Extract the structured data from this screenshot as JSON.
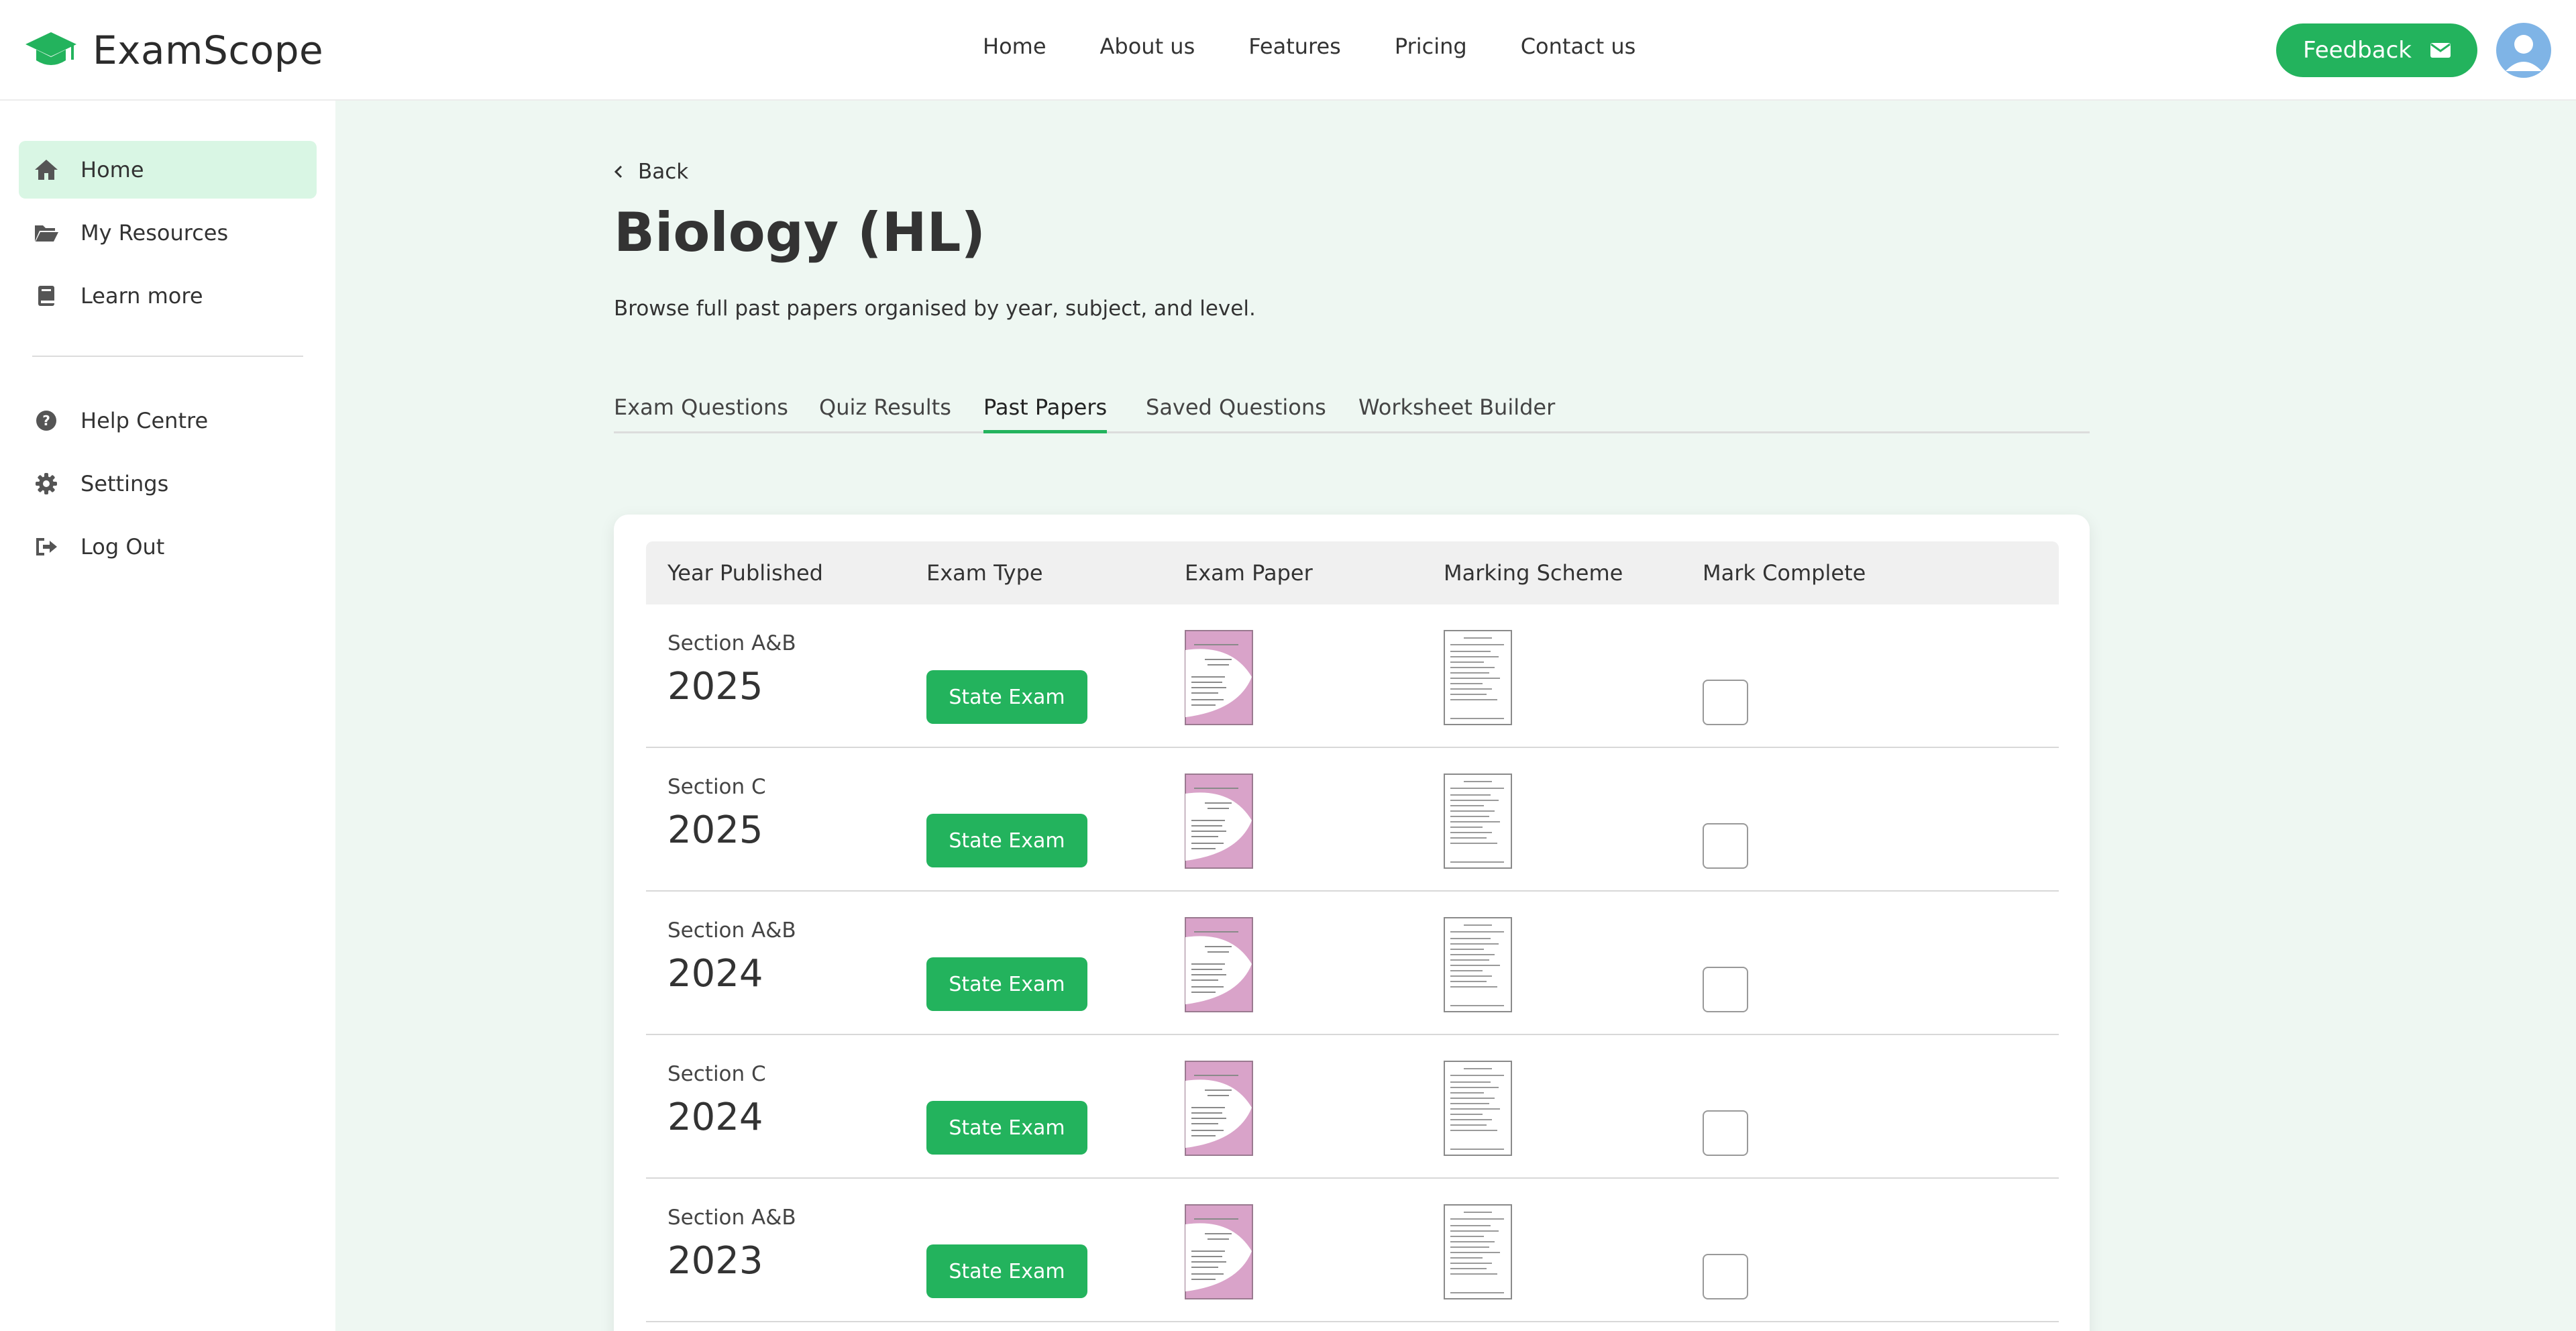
{
  "brand": {
    "name": "ExamScope",
    "icon": "graduation-cap-icon"
  },
  "topnav": [
    {
      "label": "Home"
    },
    {
      "label": "About us"
    },
    {
      "label": "Features"
    },
    {
      "label": "Pricing"
    },
    {
      "label": "Contact us"
    }
  ],
  "header": {
    "feedback_label": "Feedback",
    "feedback_icon": "mail-icon",
    "avatar_icon": "user-avatar-icon"
  },
  "sidebar": {
    "items": [
      {
        "label": "Home",
        "icon": "home-icon",
        "active": true
      },
      {
        "label": "My Resources",
        "icon": "folder-open-icon"
      },
      {
        "label": "Learn more",
        "icon": "book-icon"
      },
      {
        "label": "Help Centre",
        "icon": "help-circle-icon"
      },
      {
        "label": "Settings",
        "icon": "gear-icon"
      },
      {
        "label": "Log Out",
        "icon": "log-out-icon"
      }
    ]
  },
  "page": {
    "back_label": "Back",
    "title": "Biology (HL)",
    "subtitle": "Browse full past papers organised by year, subject, and level."
  },
  "tabs": [
    {
      "label": "Exam Questions"
    },
    {
      "label": "Quiz Results"
    },
    {
      "label": "Past Papers",
      "active": true
    },
    {
      "label": "Saved Questions"
    },
    {
      "label": "Worksheet Builder"
    }
  ],
  "table": {
    "headers": [
      "Year Published",
      "Exam Type",
      "Exam Paper",
      "Marking Scheme",
      "Mark Complete"
    ],
    "rows": [
      {
        "section": "Section A&B",
        "year": "2025",
        "exam_type": "State Exam",
        "complete": false
      },
      {
        "section": "Section C",
        "year": "2025",
        "exam_type": "State Exam",
        "complete": false
      },
      {
        "section": "Section A&B",
        "year": "2024",
        "exam_type": "State Exam",
        "complete": false
      },
      {
        "section": "Section C",
        "year": "2024",
        "exam_type": "State Exam",
        "complete": false
      },
      {
        "section": "Section A&B",
        "year": "2023",
        "exam_type": "State Exam",
        "complete": false
      }
    ]
  },
  "colors": {
    "accent": "#23b35d",
    "main_bg": "#eef7f2",
    "active_bg": "#d9f6e4",
    "paper_pink": "#d9a3c9"
  }
}
